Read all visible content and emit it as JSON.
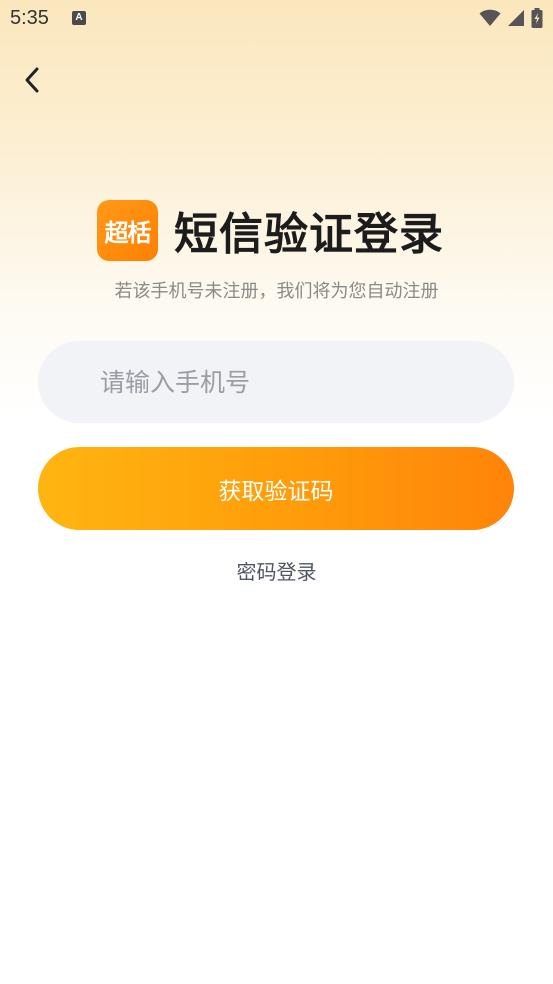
{
  "status_bar": {
    "time": "5:35",
    "notification_badge": "A",
    "icons": [
      "wifi-icon",
      "cellular-signal-icon",
      "battery-charging-icon"
    ]
  },
  "header": {
    "back_icon": "chevron-left-icon"
  },
  "brand": {
    "logo_text": "超栝",
    "logo_color": "#ff8c0a"
  },
  "login": {
    "title": "短信验证登录",
    "subtitle": "若该手机号未注册，我们将为您自动注册",
    "phone_input": {
      "value": "",
      "placeholder": "请输入手机号"
    },
    "get_code_label": "获取验证码",
    "password_login_label": "密码登录"
  },
  "colors": {
    "accent_start": "#ffb511",
    "accent_end": "#ff8409",
    "input_bg": "#f2f3f7"
  }
}
